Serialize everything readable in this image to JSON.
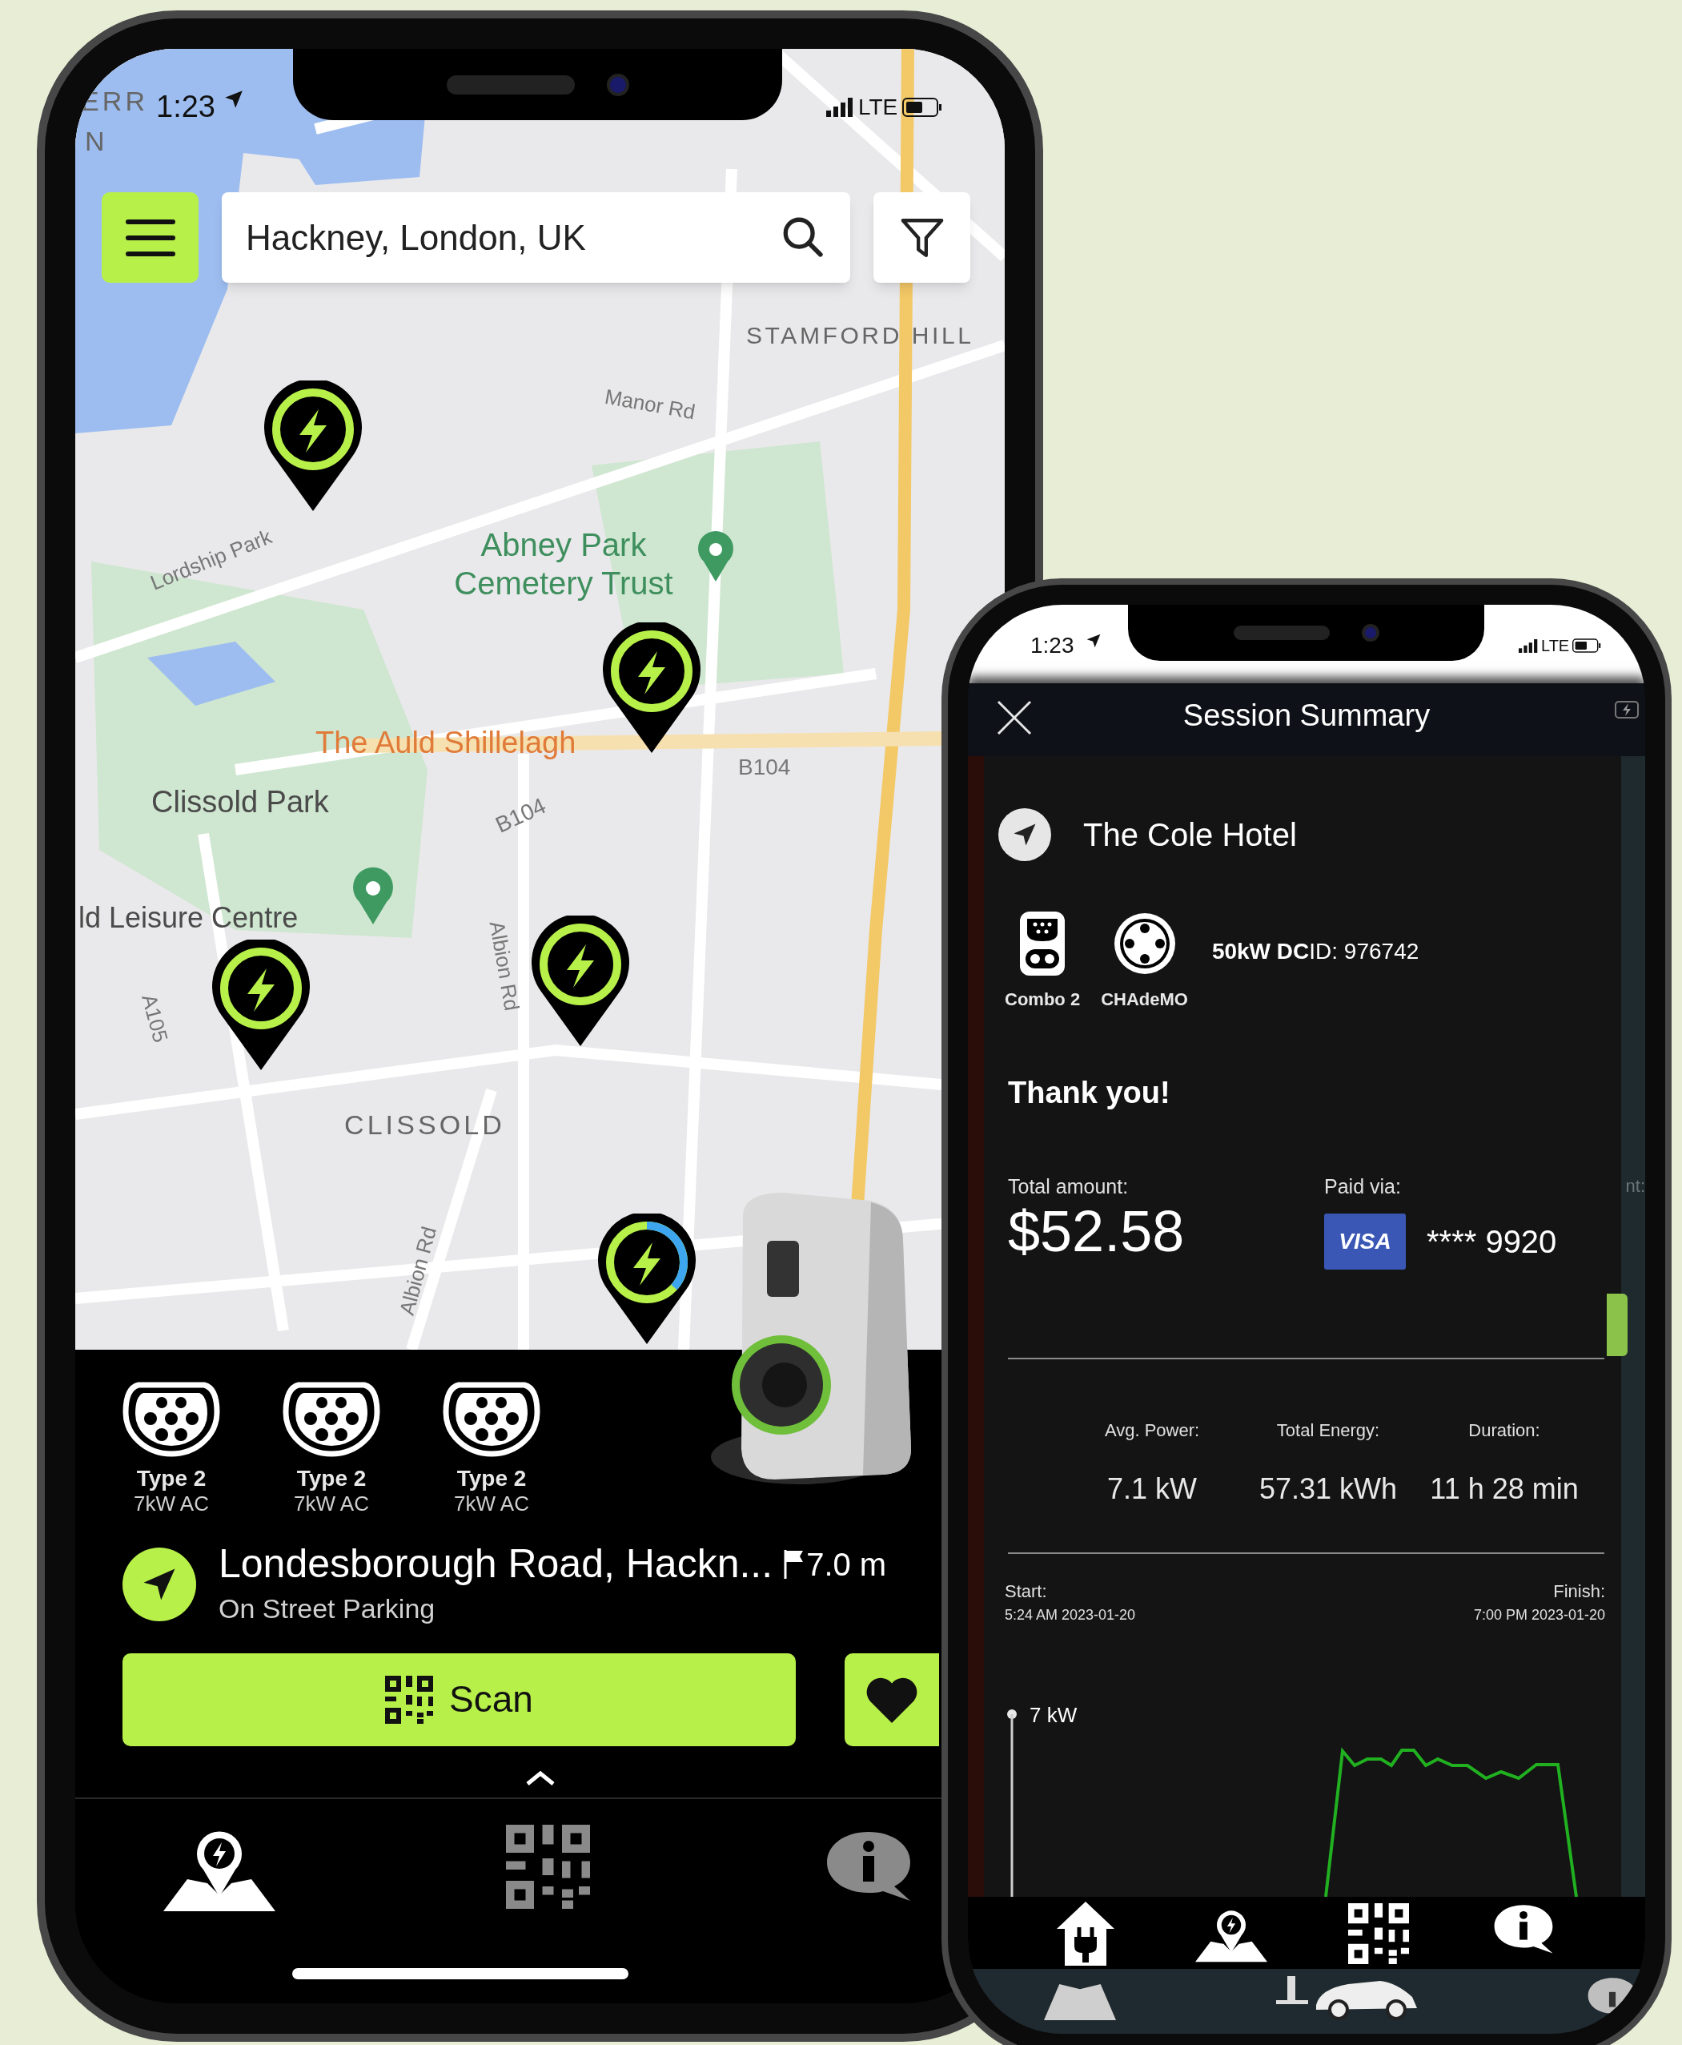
{
  "map_screen": {
    "status_bar": {
      "time": "1:23",
      "network": "LTE"
    },
    "search": {
      "value": "Hackney, London, UK"
    },
    "map_labels": [
      {
        "kind": "district",
        "text": "ERR"
      },
      {
        "kind": "district",
        "text": "N"
      },
      {
        "kind": "district",
        "text": "STAMFORD HILL"
      },
      {
        "kind": "road",
        "text": "Manor Rd"
      },
      {
        "kind": "road",
        "text": "Lordship Park"
      },
      {
        "kind": "park",
        "text": "Abney Park Cemetery Trust"
      },
      {
        "kind": "venue",
        "text": "The Auld Shillelagh"
      },
      {
        "kind": "place",
        "text": "Clissold Park"
      },
      {
        "kind": "road",
        "text": "B104"
      },
      {
        "kind": "road",
        "text": "B104"
      },
      {
        "kind": "place",
        "text": "ld Leisure Centre"
      },
      {
        "kind": "road",
        "text": "Albion Rd"
      },
      {
        "kind": "road",
        "text": "A105"
      },
      {
        "kind": "district",
        "text": "CLISSOLD"
      },
      {
        "kind": "road",
        "text": "Albion Rd"
      }
    ],
    "pins": [
      {
        "kind": "available"
      },
      {
        "kind": "available"
      },
      {
        "kind": "available"
      },
      {
        "kind": "available"
      },
      {
        "kind": "charging"
      }
    ],
    "connectors": [
      {
        "type": "Type 2",
        "power": "7kW AC"
      },
      {
        "type": "Type 2",
        "power": "7kW AC"
      },
      {
        "type": "Type 2",
        "power": "7kW AC"
      }
    ],
    "station": {
      "name": "Londesborough Road, Hackn...",
      "subtitle": "On Street Parking",
      "distance": "7.0 m"
    },
    "scan_button": {
      "label": "Scan"
    }
  },
  "session_screen": {
    "status_bar": {
      "time": "1:23",
      "network": "LTE"
    },
    "title": "Session Summary",
    "location": "The Cole Hotel",
    "connectors": [
      {
        "kind": "combo",
        "label": "Combo 2"
      },
      {
        "kind": "chademo",
        "label": "CHAdeMO"
      }
    ],
    "charger_info": "**50kW DC**ID: 976742",
    "thank_you": "Thank you!",
    "total": {
      "label": "Total amount:",
      "amount": "$52.58"
    },
    "payment": {
      "label": "Paid via:",
      "brand": "VISA",
      "card": "**** 9920"
    },
    "edge_label": "nt:",
    "stats": [
      {
        "label": "Avg. Power:",
        "value": "7.1 kW"
      },
      {
        "label": "Total Energy:",
        "value": "57.31 kWh"
      },
      {
        "label": "Duration:",
        "value": "11 h 28 min"
      }
    ],
    "start": {
      "label": "Start:",
      "time": "5:24 AM 2023-01-20"
    },
    "finish": {
      "label": "Finish:",
      "time": "7:00 PM 2023-01-20"
    },
    "chart_axis_label": "7 kW"
  }
}
